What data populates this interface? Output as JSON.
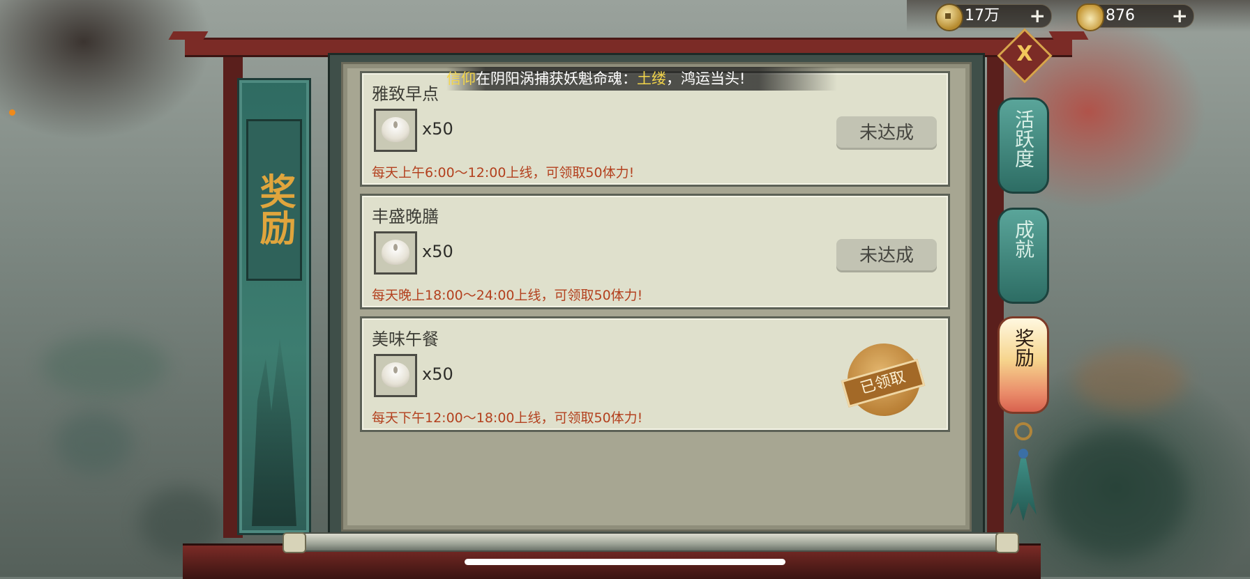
{
  "resources": [
    {
      "icon": "copper-coin-icon",
      "value": "17万",
      "add": "+"
    },
    {
      "icon": "gold-ingot-icon",
      "value": "876",
      "add": "+"
    }
  ],
  "left_banner": {
    "title": "奖励"
  },
  "broadcast": {
    "player": "信仰",
    "text_before": "在阴阳涡捕获妖魁命魂：",
    "highlight": "土缕",
    "text_after": "，鸿运当头!"
  },
  "rewards": [
    {
      "title": "雅致早点",
      "item_icon": "steamed-bun-icon",
      "quantity": "x50",
      "description": "每天上午6:00～12:00上线，可领取50体力!",
      "status": "未达成",
      "claimed": false
    },
    {
      "title": "丰盛晚膳",
      "item_icon": "steamed-bun-icon",
      "quantity": "x50",
      "description": "每天晚上18:00～24:00上线，可领取50体力!",
      "status": "未达成",
      "claimed": false
    },
    {
      "title": "美味午餐",
      "item_icon": "steamed-bun-icon",
      "quantity": "x50",
      "description": "每天下午12:00～18:00上线，可领取50体力!",
      "status": "已领取",
      "claimed": true
    }
  ],
  "close_label": "X",
  "side_tabs": [
    {
      "label": "活跃度",
      "active": false
    },
    {
      "label": "成就",
      "active": false
    },
    {
      "label": "奖励",
      "active": true
    }
  ],
  "colors": {
    "accent_gold": "#f3d54a",
    "description_red": "#b3401e",
    "tab_teal": "#2d6d64"
  }
}
